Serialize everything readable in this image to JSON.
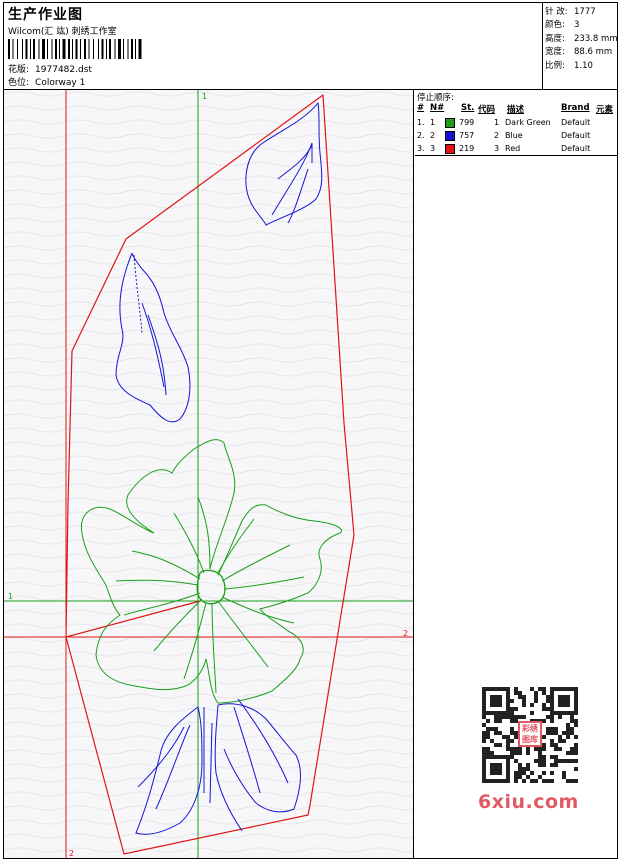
{
  "header": {
    "title": "生产作业图",
    "company": "Wilcom(汇 竑) 刺绣工作室",
    "design_label": "花版:",
    "design_value": "1977482.dst",
    "colorway_label": "色位:",
    "colorway_value": "Colorway 1"
  },
  "stats": {
    "stitches_label": "针 改:",
    "stitches_value": "1777",
    "colors_label": "颜色:",
    "colors_value": "3",
    "height_label": "高度:",
    "height_value": "233.8 mm",
    "width_label": "宽度:",
    "width_value": "88.6 mm",
    "scale_label": "比例:",
    "scale_value": "1.10"
  },
  "sequence": {
    "title": "停止顺序:",
    "headers": {
      "num": "#",
      "n": "N#",
      "st": "St.",
      "code": "代码",
      "desc": "描述",
      "brand": "Brand",
      "elem": "元素"
    },
    "rows": [
      {
        "num": "1.",
        "n": "1",
        "st": "799",
        "code": "1",
        "desc": "Dark Green",
        "brand": "Default",
        "color": "#1a9e1a"
      },
      {
        "num": "2.",
        "n": "2",
        "st": "757",
        "code": "2",
        "desc": "Blue",
        "brand": "Default",
        "color": "#1414d8"
      },
      {
        "num": "3.",
        "n": "3",
        "st": "219",
        "code": "3",
        "desc": "Red",
        "brand": "Default",
        "color": "#e01414"
      }
    ]
  },
  "canvas": {
    "axis_green_label_top": "1",
    "axis_green_label_left": "1",
    "axis_red_label_right": "2",
    "axis_red_label_bottom": "2",
    "green_color": "#1a9e1a",
    "blue_color": "#1414d8",
    "red_color": "#e01414"
  },
  "watermark": {
    "text": "6xiu.com",
    "badge_text": "彩绣图库"
  }
}
